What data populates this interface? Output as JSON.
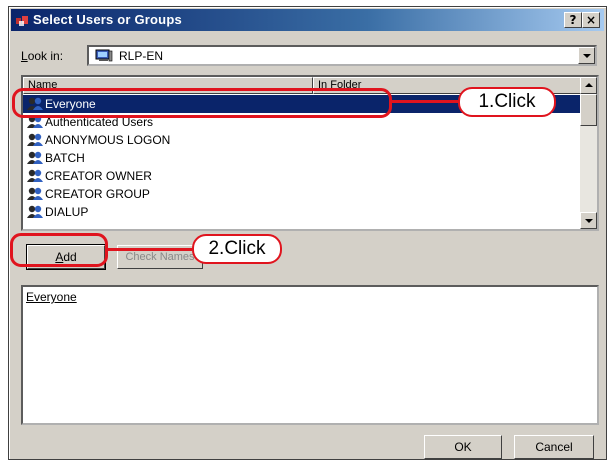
{
  "dialog": {
    "title": "Select Users or Groups",
    "help_button": "?",
    "close_button": "×"
  },
  "look_in": {
    "label": "Look in:",
    "value": "RLP-EN"
  },
  "names_list": {
    "columns": [
      "Name",
      "In Folder"
    ],
    "rows": [
      {
        "label": "Everyone",
        "selected": true
      },
      {
        "label": "Authenticated Users",
        "selected": false
      },
      {
        "label": "ANONYMOUS LOGON",
        "selected": false
      },
      {
        "label": "BATCH",
        "selected": false
      },
      {
        "label": "CREATOR OWNER",
        "selected": false
      },
      {
        "label": "CREATOR GROUP",
        "selected": false
      },
      {
        "label": "DIALUP",
        "selected": false
      }
    ]
  },
  "buttons": {
    "add": "Add",
    "check_names": "Check Names",
    "ok": "OK",
    "cancel": "Cancel"
  },
  "added": {
    "items": [
      "Everyone"
    ]
  },
  "annotations": {
    "step1": "1.Click",
    "step2": "2.Click"
  },
  "colors": {
    "annotation_red": "#e0141e",
    "selection_blue": "#0a246a",
    "dialog_gray": "#d4d0c8"
  }
}
